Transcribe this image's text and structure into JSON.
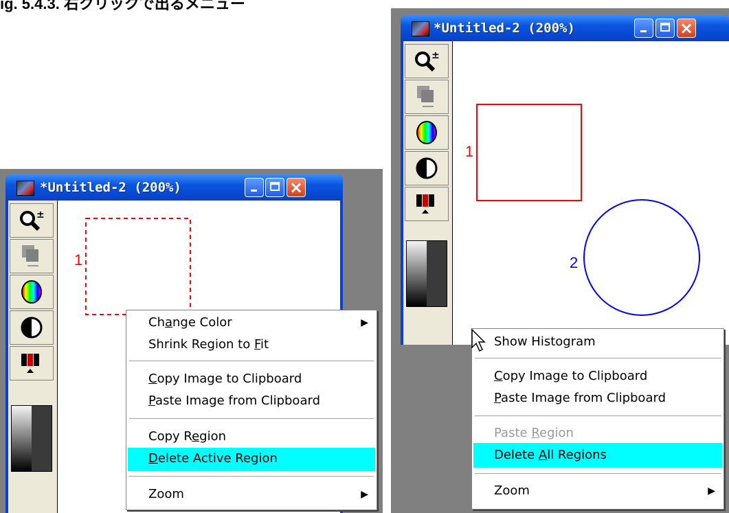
{
  "caption": "ig. 5.4.3. 右クリックで出るメニュー",
  "left_window": {
    "title": "*Untitled-2 (200%)",
    "region_label": "1",
    "menu": {
      "item1": {
        "pre": "Ch",
        "u": "a",
        "post": "nge Color"
      },
      "item2": {
        "pre": "Shrink Region to ",
        "u": "F",
        "post": "it"
      },
      "item3": {
        "pre": "",
        "u": "C",
        "post": "opy Image to Clipboard"
      },
      "item4": {
        "pre": "",
        "u": "P",
        "post": "aste Image from Clipboard"
      },
      "item5": {
        "pre": "Copy R",
        "u": "e",
        "post": "gion"
      },
      "item6": {
        "pre": "",
        "u": "D",
        "post": "elete Active Region"
      },
      "item7": {
        "label": "Zoom"
      }
    }
  },
  "right_window": {
    "title": "*Untitled-2 (200%)",
    "region1_label": "1",
    "region2_label": "2",
    "menu": {
      "item1": {
        "label": "Show Histogram"
      },
      "item2": {
        "pre": "",
        "u": "C",
        "post": "opy Image to Clipboard"
      },
      "item3": {
        "pre": "",
        "u": "P",
        "post": "aste Image from Clipboard"
      },
      "item4": {
        "pre": "Paste ",
        "u": "R",
        "post": "egion"
      },
      "item5": {
        "pre": "Delete ",
        "u": "A",
        "post": "ll Regions"
      },
      "item6": {
        "label": "Zoom"
      }
    }
  },
  "colors": {
    "highlight": "#00ffff",
    "region_red": "#ff0000",
    "region_blue": "#0000ff",
    "title_bar": "#0a55e0"
  },
  "icons": [
    "zoom-icon",
    "copy-layer-icon",
    "color-wheel-icon",
    "contrast-icon",
    "colormap-icon",
    "grayscale-bar-icon",
    "mouse-cursor-icon"
  ]
}
